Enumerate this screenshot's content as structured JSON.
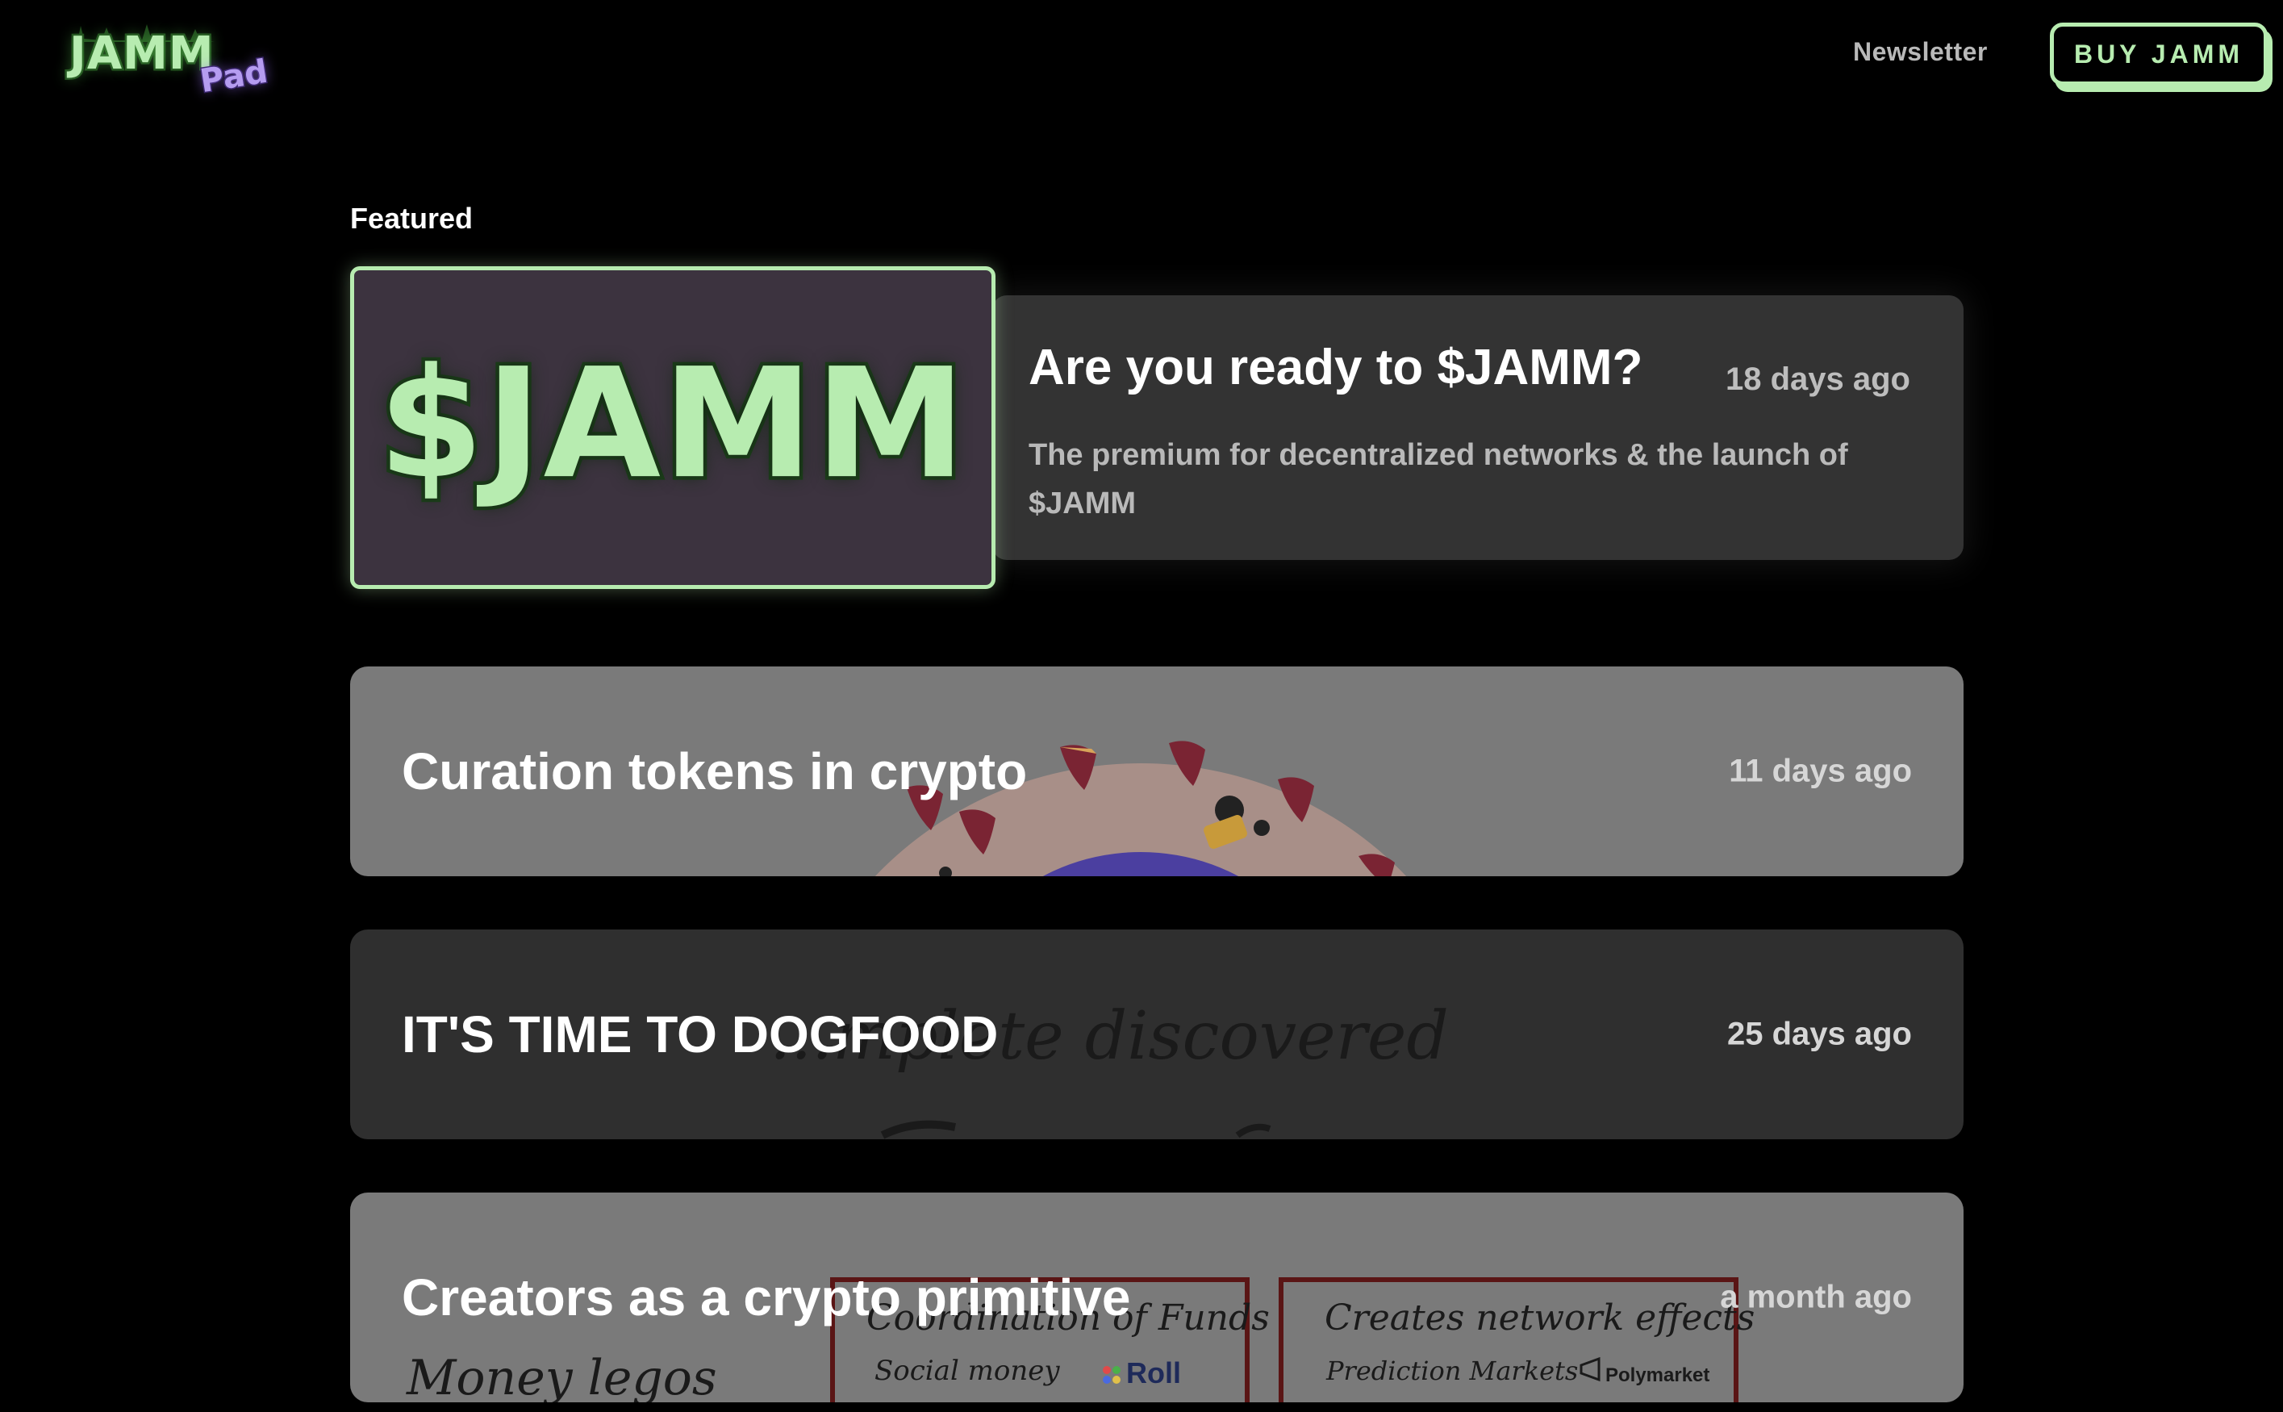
{
  "header": {
    "logo_main": "JAMM",
    "logo_sub": "Pad",
    "nav_newsletter": "Newsletter",
    "buy_label": "BUY JAMM"
  },
  "featured": {
    "section_label": "Featured",
    "image_text": "$JAMM",
    "title": "Are you ready to $JAMM?",
    "time": "18 days ago",
    "description": "The premium for decentralized networks & the launch of $JAMM"
  },
  "posts": [
    {
      "title": "Curation tokens in crypto",
      "time": "11 days ago"
    },
    {
      "title": "IT'S TIME TO DOGFOOD",
      "time": "25 days ago",
      "bg_text": "...mplete discovered"
    },
    {
      "title": "Creators as a crypto primitive",
      "time": "a month ago",
      "bg_text": {
        "left_heading": "Money legos",
        "box1_heading": "Coordination of Funds",
        "box1_item": "Social money",
        "box1_brand": "Roll",
        "box2_heading": "Creates network effects",
        "box2_item": "Prediction Markets",
        "box2_brand": "Polymarket"
      }
    }
  ],
  "colors": {
    "accent_green": "#b7ecb0",
    "logo_purple": "#b59cf0",
    "background": "#000000",
    "card_dark": "#333333",
    "card_gray": "#7a7a7a"
  }
}
